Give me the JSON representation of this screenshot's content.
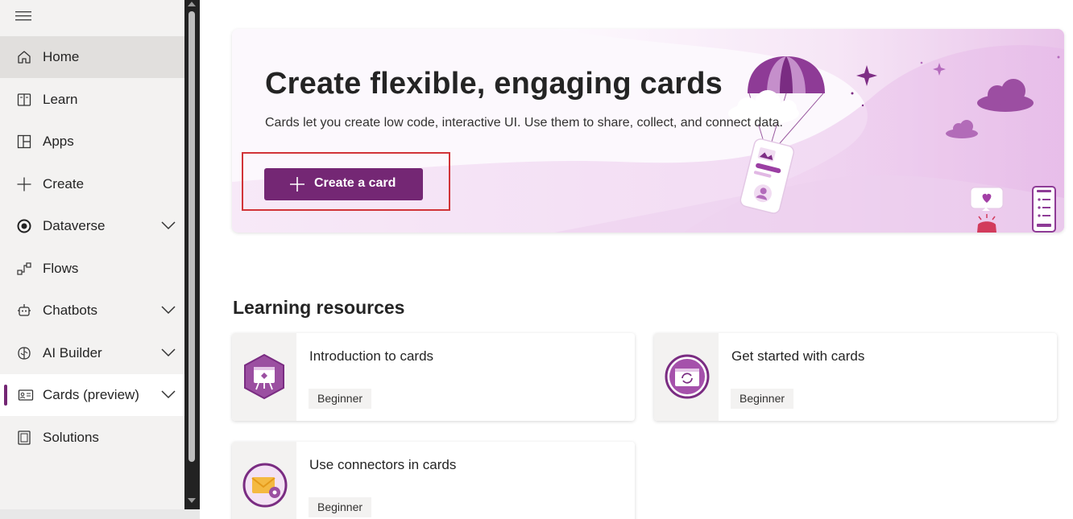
{
  "sidebar": {
    "items": [
      {
        "label": "Home",
        "icon": "home-icon",
        "has_chevron": false
      },
      {
        "label": "Learn",
        "icon": "book-icon",
        "has_chevron": false
      },
      {
        "label": "Apps",
        "icon": "apps-icon",
        "has_chevron": false
      },
      {
        "label": "Create",
        "icon": "plus-icon",
        "has_chevron": false
      },
      {
        "label": "Dataverse",
        "icon": "dataverse-icon",
        "has_chevron": true
      },
      {
        "label": "Flows",
        "icon": "flow-icon",
        "has_chevron": false
      },
      {
        "label": "Chatbots",
        "icon": "bot-icon",
        "has_chevron": true
      },
      {
        "label": "AI Builder",
        "icon": "brain-icon",
        "has_chevron": true
      },
      {
        "label": "Cards (preview)",
        "icon": "cards-icon",
        "has_chevron": true
      },
      {
        "label": "Solutions",
        "icon": "solutions-icon",
        "has_chevron": false
      }
    ]
  },
  "hero": {
    "title": "Create flexible, engaging cards",
    "subtitle": "Cards let you create low code, interactive UI. Use them to share, collect, and connect data.",
    "button_label": "Create a card"
  },
  "learning": {
    "title": "Learning resources",
    "cards": [
      {
        "title": "Introduction to cards",
        "level": "Beginner",
        "icon": "presentation-icon"
      },
      {
        "title": "Get started with cards",
        "level": "Beginner",
        "icon": "card-sync-icon"
      },
      {
        "title": "Use connectors in cards",
        "level": "Beginner",
        "icon": "mail-gear-icon"
      }
    ]
  },
  "colors": {
    "accent": "#742774",
    "highlight": "#d13438",
    "sidebar_bg": "#f3f2f1"
  }
}
